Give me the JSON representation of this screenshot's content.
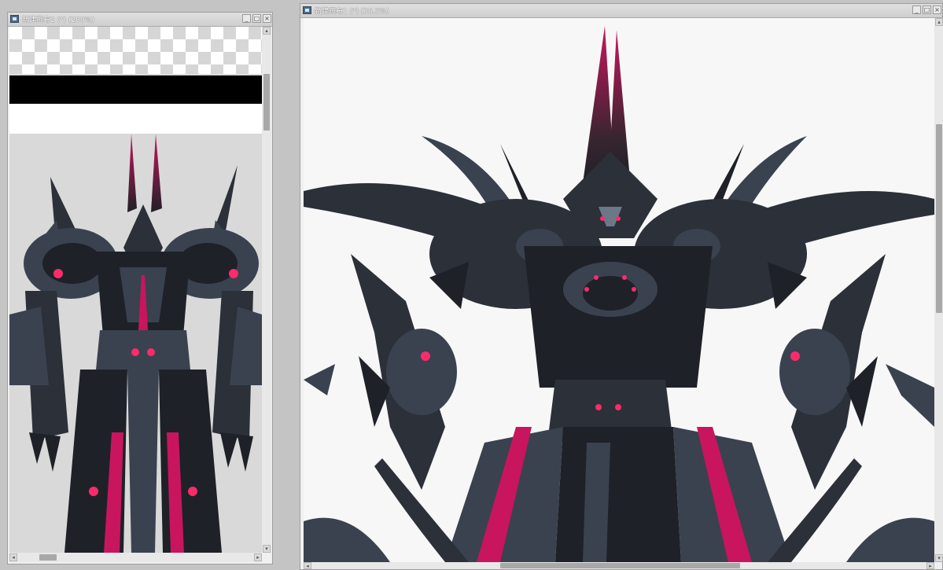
{
  "windows": {
    "left": {
      "title": "新建画布2 (*) (200%)",
      "minimize": "_",
      "maximize": "□",
      "close": "×"
    },
    "right": {
      "title": "新建画布1 (*) (35.3%)",
      "minimize": "_",
      "maximize": "□",
      "close": "×"
    }
  },
  "scroll_arrows": {
    "up": "▴",
    "down": "▾",
    "left": "◂",
    "right": "▸"
  },
  "colors": {
    "armor_dark": "#1e2128",
    "armor_mid": "#3a4250",
    "armor_light": "#6c7888",
    "accent_magenta": "#c8155e",
    "eye_red": "#ff2a6a",
    "canvas_bg": "#f7f7f7",
    "ref_bg": "#d9d9d9"
  },
  "icons": [
    "canvas-window-icon",
    "minimize-icon",
    "maximize-icon",
    "close-icon"
  ]
}
